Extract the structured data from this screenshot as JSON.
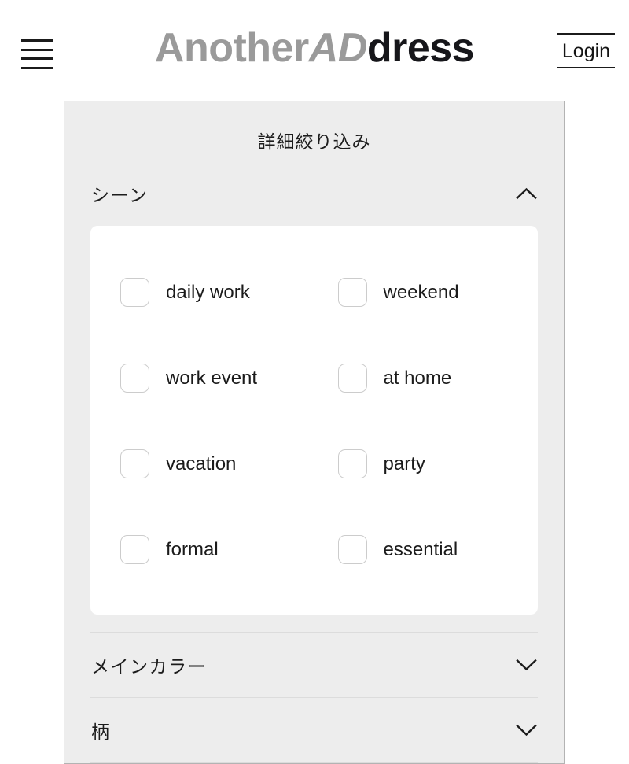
{
  "header": {
    "menu_icon": "hamburger-icon",
    "brand": {
      "part1": "Another",
      "part2": "AD",
      "part3": "dress"
    },
    "login_label": "Login"
  },
  "filter_panel": {
    "title": "詳細絞り込み",
    "sections": [
      {
        "label": "シーン",
        "state": "expanded",
        "chevron": "chevron-up-icon",
        "options": [
          {
            "label": "daily work",
            "checked": false
          },
          {
            "label": "weekend",
            "checked": false
          },
          {
            "label": "work event",
            "checked": false
          },
          {
            "label": "at home",
            "checked": false
          },
          {
            "label": "vacation",
            "checked": false
          },
          {
            "label": "party",
            "checked": false
          },
          {
            "label": "formal",
            "checked": false
          },
          {
            "label": "essential",
            "checked": false
          }
        ]
      },
      {
        "label": "メインカラー",
        "state": "collapsed",
        "chevron": "chevron-down-icon",
        "options": []
      },
      {
        "label": "柄",
        "state": "collapsed",
        "chevron": "chevron-down-icon",
        "options": []
      }
    ]
  },
  "colors": {
    "page_background": "#ffffff",
    "panel_background": "#ededed",
    "panel_border": "#b3b3b3",
    "card_background": "#ffffff",
    "checkbox_border": "#cccccc",
    "text_primary": "#1b1b1b",
    "brand_gray": "#9a9a9a",
    "brand_black": "#16161a",
    "divider": "#dcdcdc"
  }
}
